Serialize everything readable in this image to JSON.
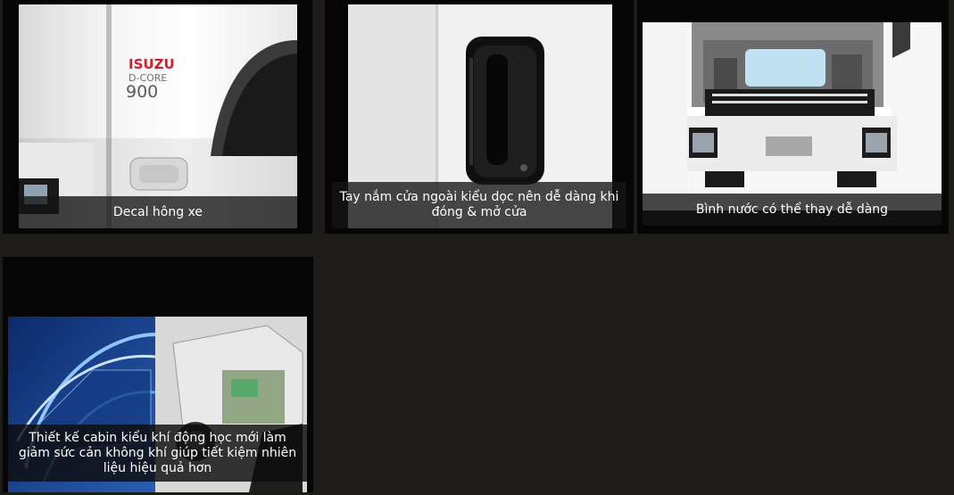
{
  "gallery": {
    "items": [
      {
        "caption": "Decal hông xe",
        "image_label": "ISUZU",
        "image_sublabel": "D-CORE",
        "image_model": "900"
      },
      {
        "caption": "Tay nắm cửa ngoài kiểu dọc nên dễ dàng khi đóng & mở cửa"
      },
      {
        "caption": "Bình nước có thể thay dễ dàng"
      },
      {
        "caption": "Thiết kế cabin kiểu khí động học mới làm giảm sức cản không khí giúp tiết kiệm nhiên liệu hiệu quả hơn"
      }
    ]
  },
  "colors": {
    "background": "#1c1b17",
    "card": "#050505",
    "brand_red": "#d0202c"
  }
}
